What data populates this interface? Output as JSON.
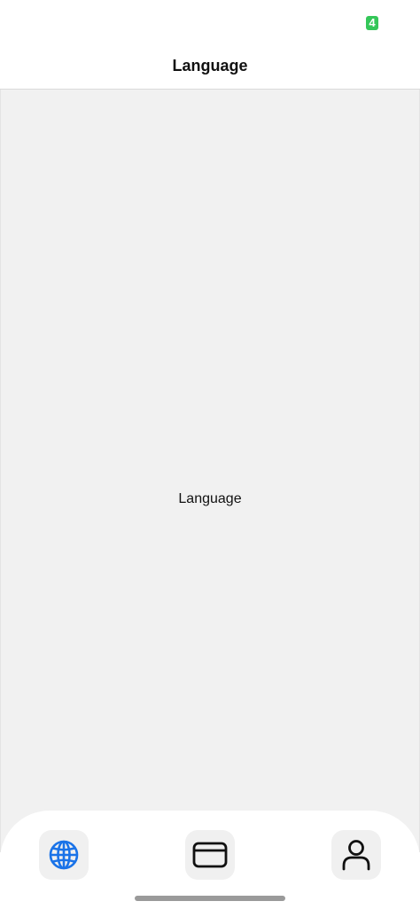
{
  "status_bar": {
    "battery_level": "4",
    "battery_color": "#34c759"
  },
  "nav": {
    "title": "Language"
  },
  "content": {
    "label": "Language"
  },
  "tab_bar": {
    "tabs": [
      {
        "name": "language",
        "icon": "globe-icon",
        "active": true,
        "color": "#1a73e8"
      },
      {
        "name": "card",
        "icon": "credit-card-icon",
        "active": false,
        "color": "#111111"
      },
      {
        "name": "profile",
        "icon": "person-icon",
        "active": false,
        "color": "#111111"
      }
    ]
  }
}
